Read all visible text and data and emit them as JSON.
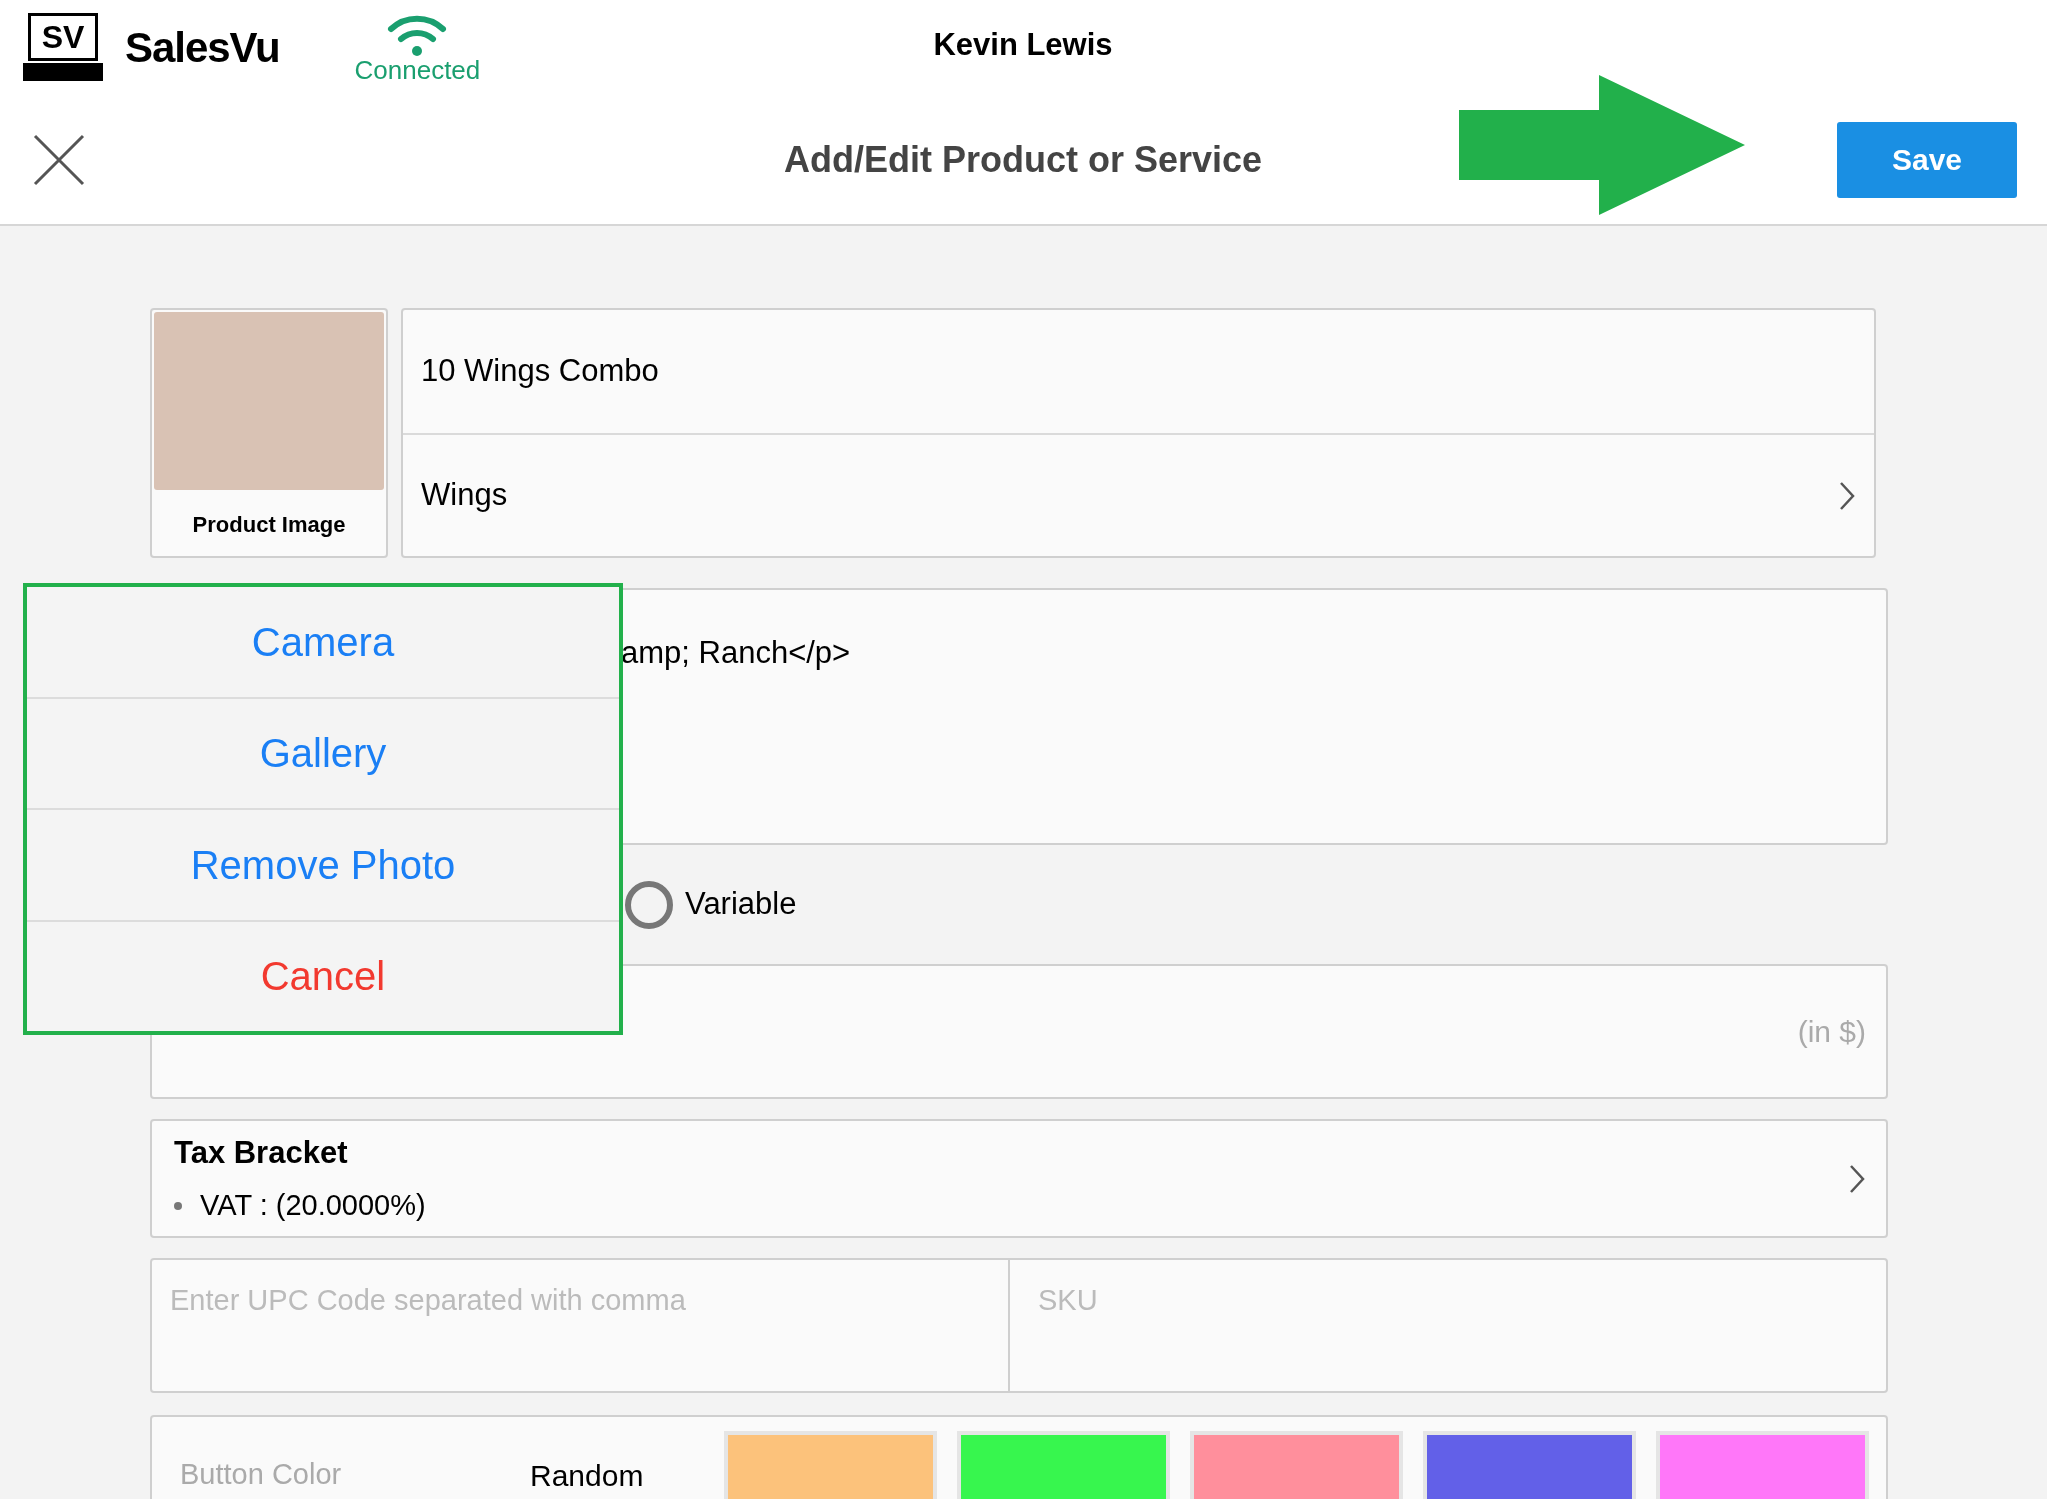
{
  "header": {
    "logo_mark": "SV",
    "brand": "SalesVu",
    "connection": "Connected",
    "user": "Kevin Lewis"
  },
  "toolbar": {
    "title": "Add/Edit Product or Service",
    "save": "Save"
  },
  "product": {
    "image_label": "Product Image",
    "name": "10 Wings Combo",
    "category": "Wings",
    "description": "amp; Ranch</p>"
  },
  "pricing": {
    "options": [
      {
        "label": "Variable",
        "selected": false
      }
    ],
    "price_unit": "(in $)"
  },
  "tax": {
    "title": "Tax Bracket",
    "items": [
      "VAT : (20.0000%)"
    ]
  },
  "codes": {
    "upc_placeholder": "Enter UPC Code separated with comma",
    "sku_placeholder": "SKU"
  },
  "button_color": {
    "label": "Button Color",
    "value": "Random",
    "swatches": [
      {
        "color": "#fcc27b"
      },
      {
        "color": "#37f64e"
      },
      {
        "color": "#ff8f9c"
      },
      {
        "color": "#6260e8"
      },
      {
        "color": "#ff77f9"
      }
    ]
  },
  "photo_menu": {
    "items": [
      {
        "label": "Camera",
        "kind": "action"
      },
      {
        "label": "Gallery",
        "kind": "action"
      },
      {
        "label": "Remove Photo",
        "kind": "action"
      },
      {
        "label": "Cancel",
        "kind": "cancel"
      }
    ]
  }
}
